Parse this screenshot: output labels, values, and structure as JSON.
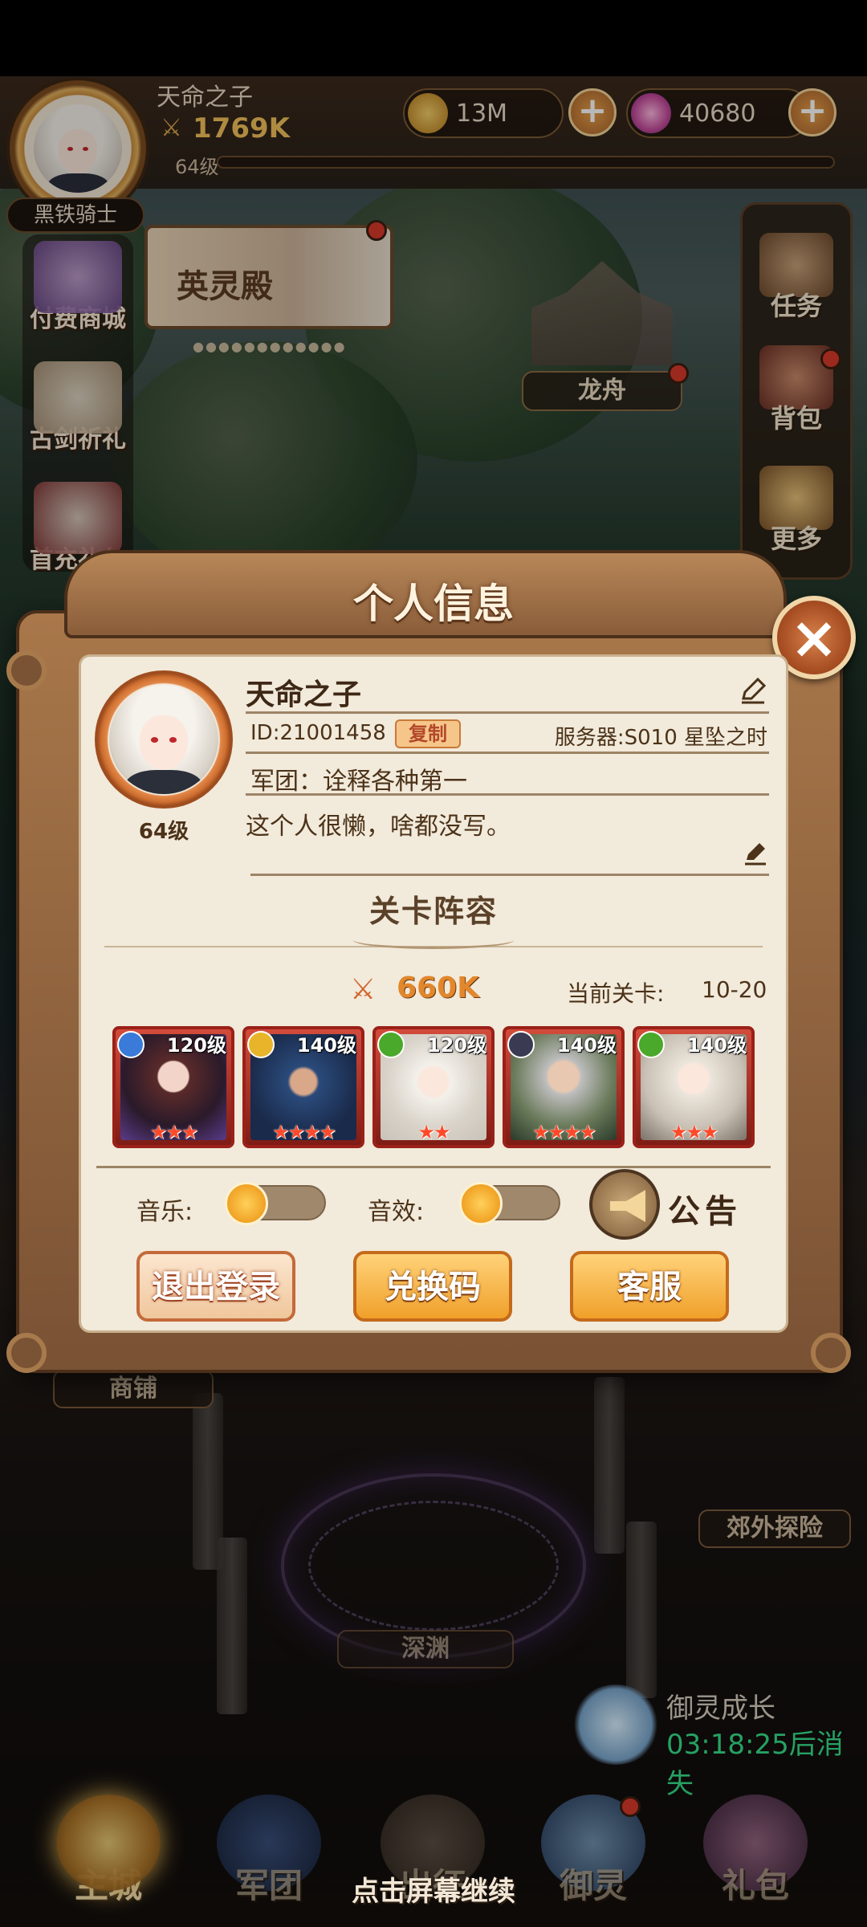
{
  "player": {
    "name": "天命之子",
    "power": "1769K",
    "level": "64级",
    "title": "黑铁骑士"
  },
  "currencies": [
    {
      "name": "gold-coin",
      "value": "13M"
    },
    {
      "name": "diamond",
      "value": "40680"
    }
  ],
  "banner": {
    "title": "英灵殿",
    "dots": "●●●●●●●●●●●●"
  },
  "left_menu": [
    {
      "label": "付费商城",
      "icon": "gift-icon"
    },
    {
      "label": "古剑祈礼",
      "icon": "hero-icon"
    },
    {
      "label": "首充礼包",
      "icon": "hero-icon"
    }
  ],
  "right_menu": [
    {
      "label": "任务",
      "icon": "scroll-icon",
      "badge": false
    },
    {
      "label": "背包",
      "icon": "bag-icon",
      "badge": true
    },
    {
      "label": "更多",
      "icon": "grid-icon",
      "badge": false
    }
  ],
  "map_labels": {
    "longzhou": "龙舟",
    "shop": "商铺",
    "explore": "郊外探险",
    "abyss": "深渊"
  },
  "growth": {
    "title": "御灵成长",
    "timer": "03:18:25后消失"
  },
  "bottom_nav": [
    {
      "label": "主城",
      "active": true
    },
    {
      "label": "军团",
      "active": false
    },
    {
      "label": "出征",
      "active": false
    },
    {
      "label": "御灵",
      "active": false
    },
    {
      "label": "礼包",
      "active": false
    }
  ],
  "continue_hint": "点击屏幕继续",
  "popup": {
    "title": "个人信息",
    "close_icon": "×",
    "profile": {
      "name": "天命之子",
      "level": "64级",
      "id": "ID:21001458",
      "copy_label": "复制",
      "server": "服务器:S010 星坠之时",
      "guild": "军团：诠释各种第一",
      "signature": "这个人很懒，啥都没写。"
    },
    "lineup": {
      "title": "关卡阵容",
      "power": "660K",
      "stage_label": "当前关卡:",
      "stage_value": "10-20",
      "heroes": [
        {
          "level": "120级",
          "stars": "★★★",
          "element": "water",
          "element_color": "#3a7ad8"
        },
        {
          "level": "140级",
          "stars": "★★★★",
          "element": "light",
          "element_color": "#e8b42a"
        },
        {
          "level": "120级",
          "stars": "★★",
          "element": "wind",
          "element_color": "#4aa82a"
        },
        {
          "level": "140级",
          "stars": "★★★★",
          "element": "dark",
          "element_color": "#3a3a52"
        },
        {
          "level": "140级",
          "stars": "★★★",
          "element": "wind",
          "element_color": "#4aa82a"
        }
      ]
    },
    "settings": {
      "music_label": "音乐:",
      "music_on": false,
      "sound_label": "音效:",
      "sound_on": false,
      "notice_label": "公告"
    },
    "buttons": {
      "logout": "退出登录",
      "redeem": "兑换码",
      "support": "客服"
    }
  },
  "colors": {
    "frame": "#7a5234",
    "panel": "#f2eadb",
    "accent_gold": "#f0a02a",
    "power_orange": "#e2872c",
    "timer_green": "#35e08a"
  }
}
